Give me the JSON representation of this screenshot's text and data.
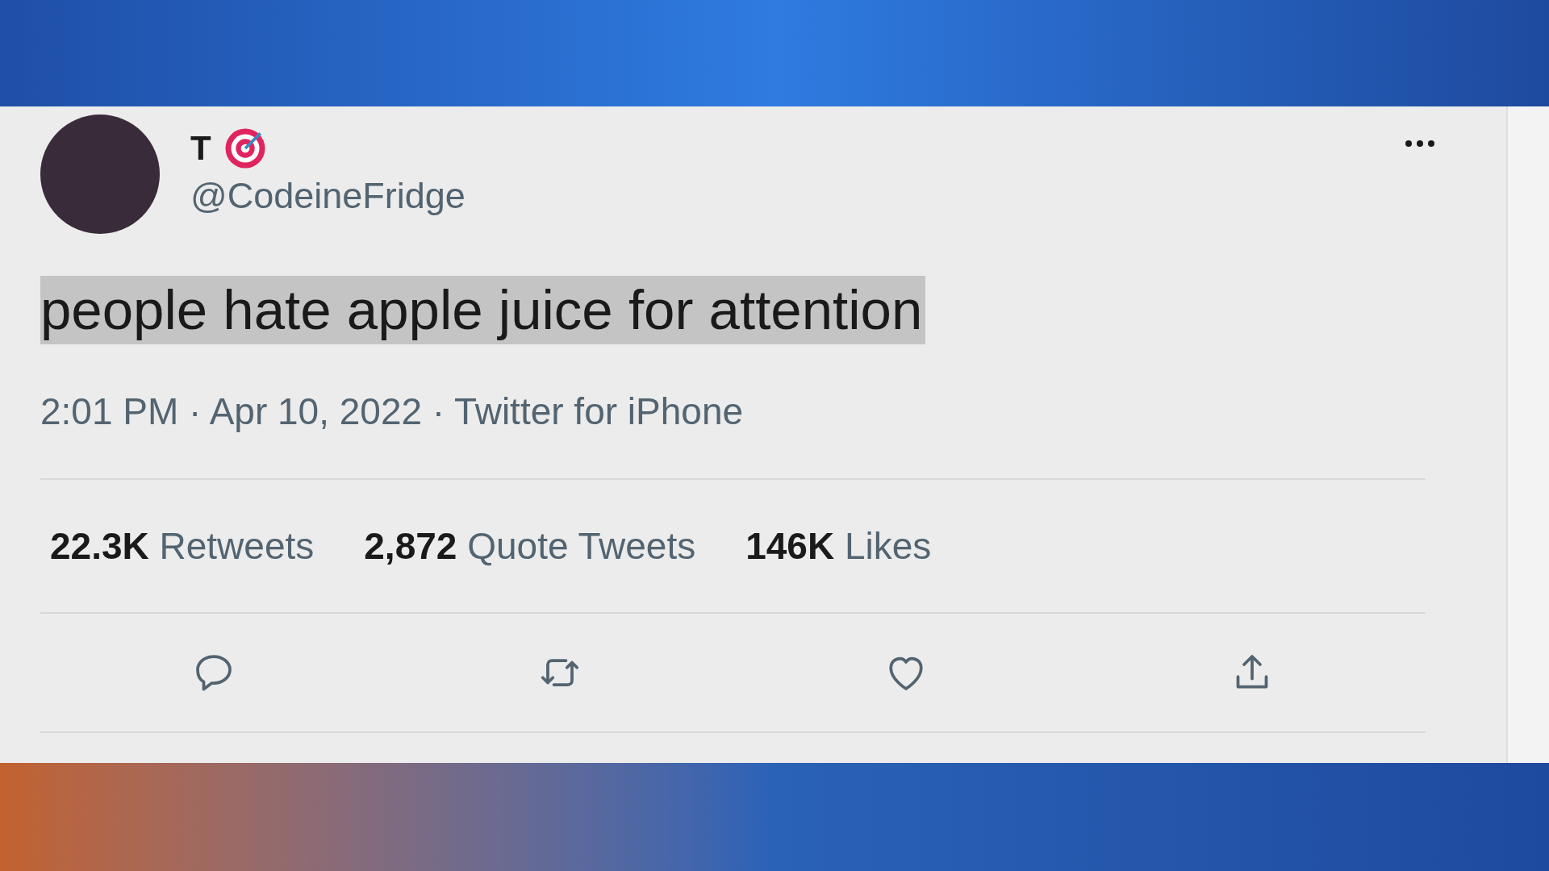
{
  "tweet": {
    "author_name": "T",
    "handle": "@CodeineFridge",
    "text": "people hate apple juice for attention",
    "text_selected": true,
    "timestamp": "2:01 PM · Apr 10, 2022 · Twitter for iPhone",
    "stats": [
      {
        "count": "22.3K",
        "label": "Retweets"
      },
      {
        "count": "2,872",
        "label": "Quote Tweets"
      },
      {
        "count": "146K",
        "label": "Likes"
      }
    ],
    "actions": [
      {
        "kind": "reply"
      },
      {
        "kind": "retweet"
      },
      {
        "kind": "like"
      },
      {
        "kind": "share"
      }
    ]
  }
}
